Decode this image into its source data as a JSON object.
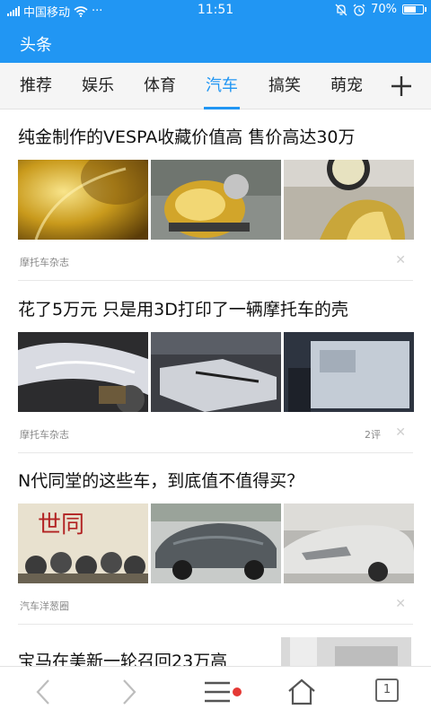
{
  "status_bar": {
    "carrier": "中国移动",
    "time": "11:51",
    "battery_level": 0.7,
    "battery_text": "70%",
    "more_label": "···"
  },
  "header": {
    "title": "头条"
  },
  "tabs": [
    {
      "label": "推荐"
    },
    {
      "label": "娱乐"
    },
    {
      "label": "体育"
    },
    {
      "label": "汽车",
      "active": true
    },
    {
      "label": "搞笑"
    },
    {
      "label": "萌宠"
    }
  ],
  "articles": [
    {
      "title": "纯金制作的VESPA收藏价值高 售价高达30万",
      "source": "摩托车杂志",
      "comments": ""
    },
    {
      "title": "花了5万元 只是用3D打印了一辆摩托车的壳",
      "source": "摩托车杂志",
      "comments": "2评"
    },
    {
      "title": "N代同堂的这些车，到底值不值得买？",
      "source": "汽车洋葱圈",
      "comments": ""
    },
    {
      "title": "宝马在美新一轮召回23万高"
    }
  ],
  "dismiss_glyph": "✕",
  "thumb_caption": "世同",
  "bottom_nav": {
    "tab_count": "1"
  },
  "colors": {
    "accent": "#2196F3",
    "notification_dot": "#e53935"
  },
  "icons": [
    "signal-icon",
    "wifi-icon",
    "mute-icon",
    "alarm-icon",
    "battery-icon",
    "add-tab-icon",
    "back-icon",
    "forward-icon",
    "menu-icon",
    "home-icon",
    "tabs-icon"
  ]
}
